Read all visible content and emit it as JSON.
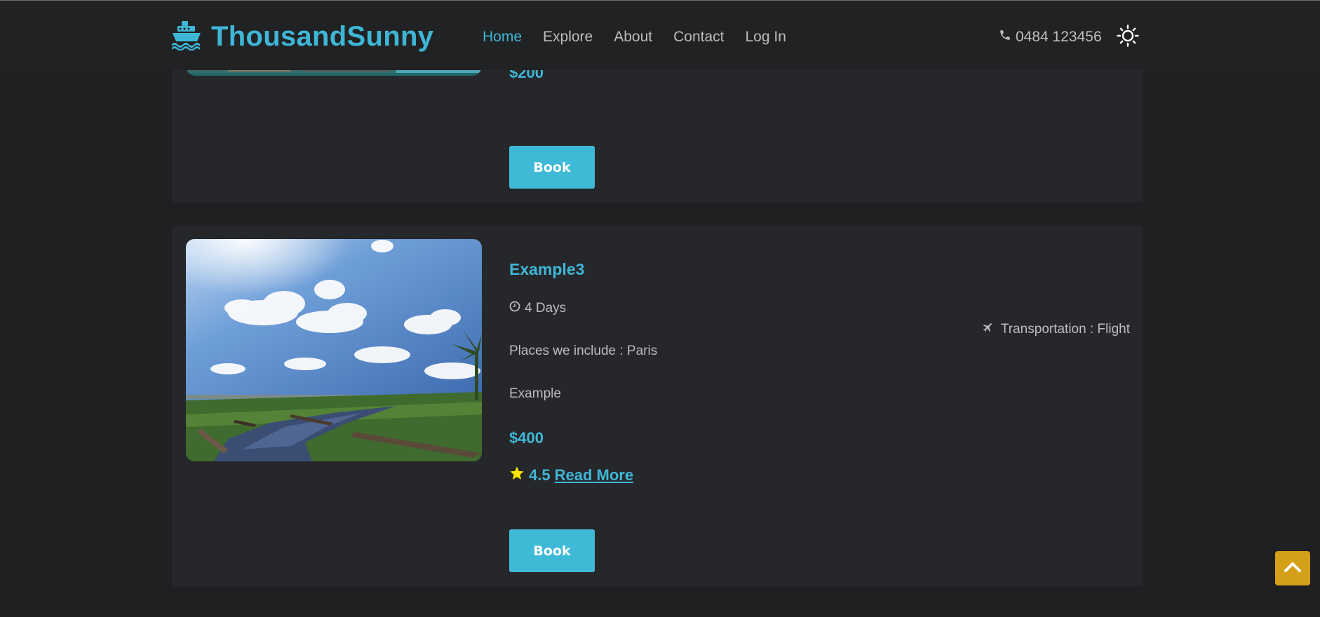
{
  "brand": {
    "name": "ThousandSunny",
    "icon": "ship-icon"
  },
  "nav": {
    "items": [
      {
        "label": "Home",
        "active": true
      },
      {
        "label": "Explore",
        "active": false
      },
      {
        "label": "About",
        "active": false
      },
      {
        "label": "Contact",
        "active": false
      },
      {
        "label": "Log In",
        "active": false
      }
    ],
    "phone": "0484 123456",
    "phone_icon": "phone-icon",
    "theme_icon": "sun-icon"
  },
  "tours": [
    {
      "price": "$200",
      "book_label": "Book"
    },
    {
      "title": "Example3",
      "duration": "4 Days",
      "places": "Places we include  : Paris",
      "description": "Example",
      "price": "$400",
      "rating": "4.5",
      "read_more": "Read More",
      "transportation": "Transportation  : Flight",
      "book_label": "Book"
    }
  ],
  "colors": {
    "accent": "#3fb6d6",
    "button": "#3fbad6",
    "scroll_top": "#d4a017",
    "star": "#ffe600"
  },
  "scroll_top_icon": "chevron-up-icon"
}
